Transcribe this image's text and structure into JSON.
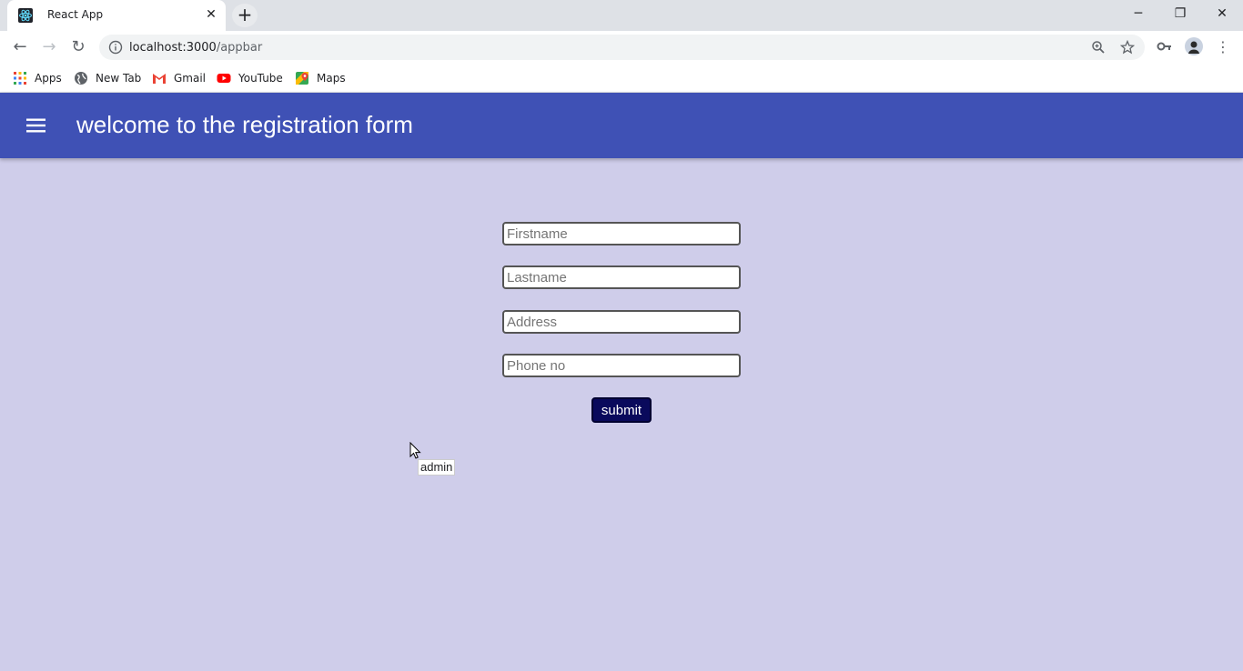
{
  "browser": {
    "tab_title": "React App",
    "url_host": "localhost:3000",
    "url_path": "/appbar",
    "bookmarks": [
      {
        "label": "Apps",
        "icon": "apps-grid-icon"
      },
      {
        "label": "New Tab",
        "icon": "globe-icon"
      },
      {
        "label": "Gmail",
        "icon": "gmail-icon"
      },
      {
        "label": "YouTube",
        "icon": "youtube-icon"
      },
      {
        "label": "Maps",
        "icon": "maps-icon"
      }
    ]
  },
  "appbar": {
    "title": "welcome to the registration form",
    "color": "#3f51b5"
  },
  "form": {
    "firstname_placeholder": "Firstname",
    "lastname_placeholder": "Lastname",
    "address_placeholder": "Address",
    "phone_placeholder": "Phone no",
    "submit_label": "submit"
  },
  "tooltip": {
    "text": "admin"
  },
  "colors": {
    "page_background": "#cfcdea",
    "submit_background": "#0a0a5c"
  }
}
